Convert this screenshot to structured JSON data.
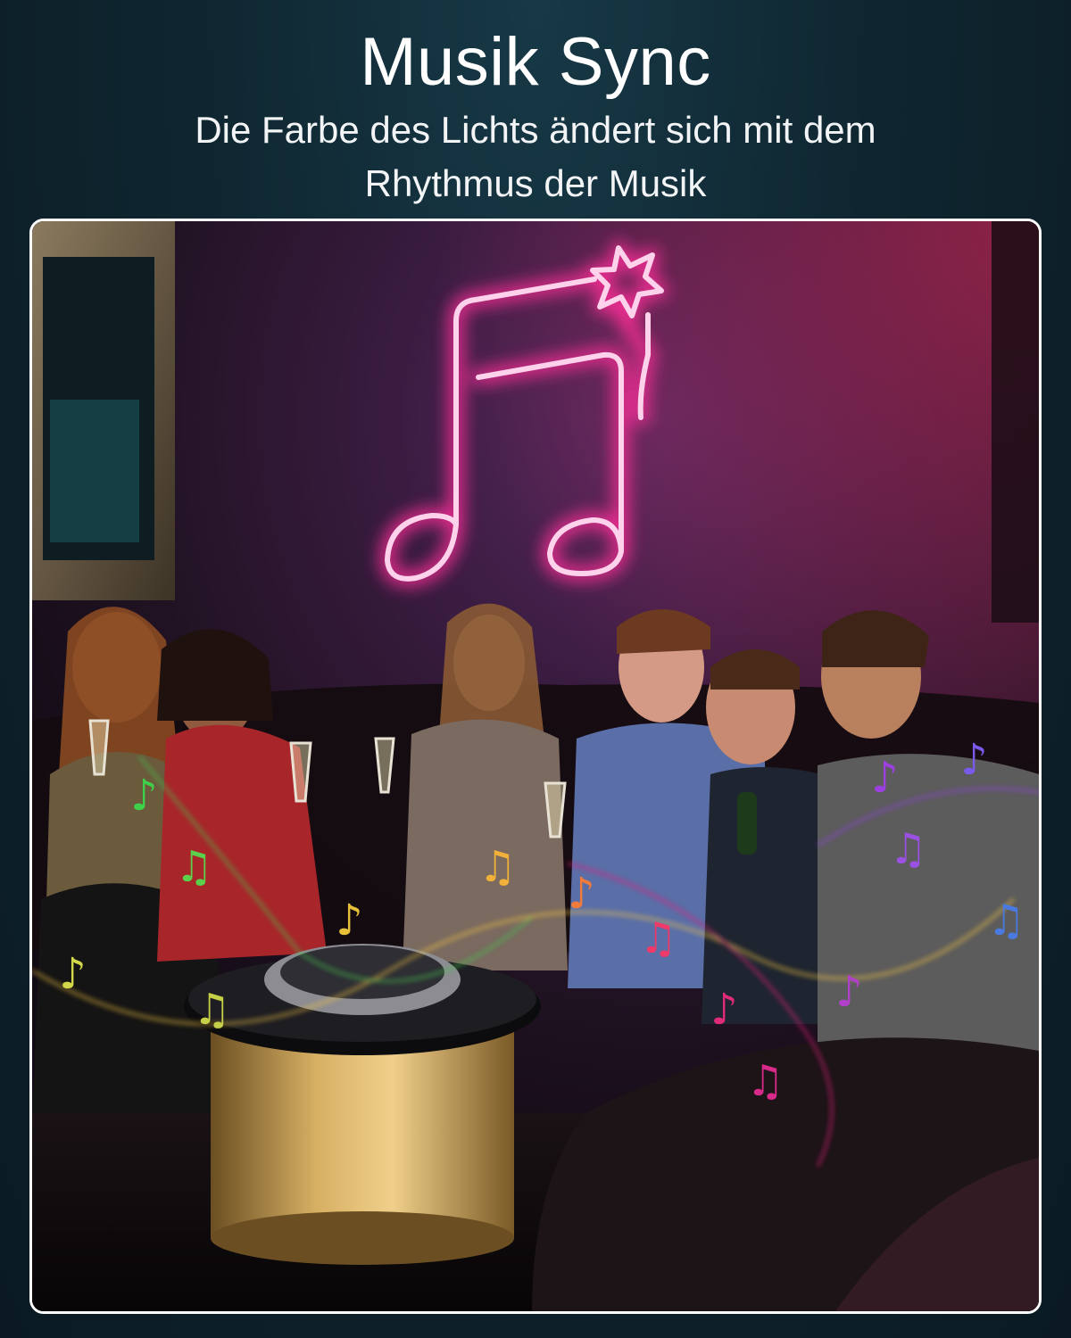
{
  "header": {
    "title": "Musik Sync",
    "subtitle_line1": "Die Farbe des Lichts ändert sich mit dem",
    "subtitle_line2": "Rhythmus der Musik"
  },
  "colors": {
    "background": "#0f2630",
    "neon": "#ff2f9a",
    "frame_border": "#ffffff"
  }
}
